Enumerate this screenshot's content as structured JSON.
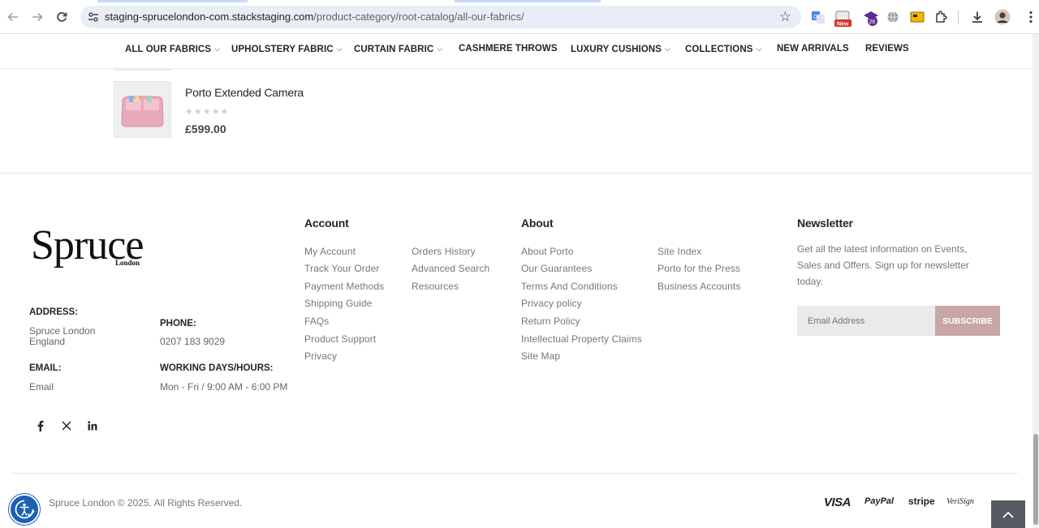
{
  "browser": {
    "url_domain": "staging-sprucelondon-com.stackstaging.com",
    "url_path": "/product-category/root-catalog/all-our-fabrics/",
    "extension_badge_new": "New",
    "extension_badge_count": "26"
  },
  "nav": {
    "items": [
      {
        "label": "ALL OUR FABRICS",
        "has_dropdown": true
      },
      {
        "label": "UPHOLSTERY FABRIC",
        "has_dropdown": true
      },
      {
        "label": "CURTAIN FABRIC",
        "has_dropdown": true
      },
      {
        "label": "CASHMERE THROWS",
        "has_dropdown": false
      },
      {
        "label": "LUXURY CUSHIONS",
        "has_dropdown": true
      },
      {
        "label": "COLLECTIONS",
        "has_dropdown": true
      },
      {
        "label": "NEW ARRIVALS",
        "has_dropdown": false
      },
      {
        "label": "REVIEWS",
        "has_dropdown": false
      }
    ]
  },
  "product": {
    "name": "Porto Extended Camera",
    "rating": 0,
    "stars": "★★★★★",
    "price": "£599.00"
  },
  "footer": {
    "logo_text": "Spruce",
    "logo_subtext": "London",
    "contact": {
      "address_label": "ADDRESS:",
      "address_line1": "Spruce London",
      "address_line2": "England",
      "phone_label": "PHONE:",
      "phone_value": "0207 183 9029",
      "email_label": "EMAIL:",
      "email_value": "Email",
      "hours_label": "WORKING DAYS/HOURS:",
      "hours_value": "Mon - Fri / 9:00 AM - 6:00 PM"
    },
    "social_icons": [
      "facebook-icon",
      "x-twitter-icon",
      "linkedin-icon"
    ],
    "account": {
      "title": "Account",
      "col1": [
        "My Account",
        "Track Your Order",
        "Payment Methods",
        "Shipping Guide",
        "FAQs",
        "Product Support",
        "Privacy"
      ],
      "col2": [
        "Orders History",
        "Advanced Search",
        "Resources"
      ]
    },
    "about": {
      "title": "About",
      "col1": [
        "About Porto",
        "Our Guarantees",
        "Terms And Conditions",
        "Privacy policy",
        "Return Policy",
        "Intellectual Property Claims",
        "Site Map"
      ],
      "col2": [
        "Site Index",
        "Porto for the Press",
        "Business Accounts"
      ]
    },
    "newsletter": {
      "title": "Newsletter",
      "text": "Get all the latest information on Events, Sales and Offers. Sign up for newsletter today.",
      "email_placeholder": "Email Address",
      "subscribe_label": "SUBSCRIBE"
    },
    "copyright": "Spruce London © 2025. All Rights Reserved.",
    "payments": [
      "VISA",
      "PayPal",
      "stripe",
      "VeriSign"
    ]
  },
  "colors": {
    "accent": "#c9a6a6",
    "text_dark": "#222529",
    "text_muted": "#777777",
    "a11y_blue": "#1d5fb5"
  }
}
